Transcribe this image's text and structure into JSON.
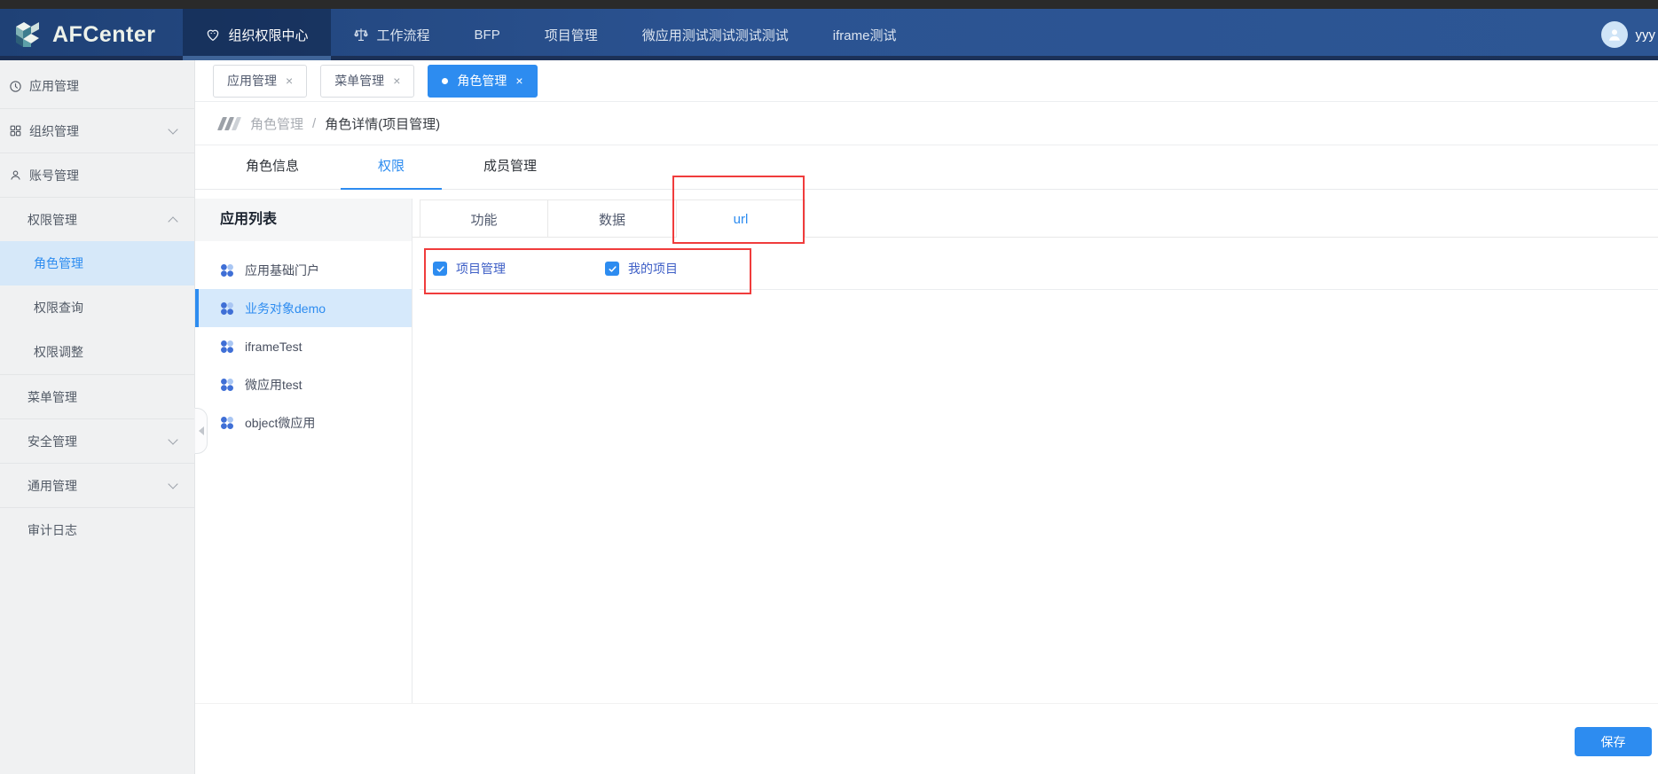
{
  "brand": {
    "name": "AFCenter"
  },
  "user": {
    "name": "yyy"
  },
  "glyphs": {
    "close": "×"
  },
  "topnav": {
    "items": [
      {
        "label": "组织权限中心",
        "icon": "heart-icon",
        "active": true
      },
      {
        "label": "工作流程",
        "icon": "scales-icon",
        "active": false
      },
      {
        "label": "BFP",
        "active": false
      },
      {
        "label": "项目管理",
        "active": false
      },
      {
        "label": "微应用测试测试测试测试",
        "active": false
      },
      {
        "label": "iframe测试",
        "active": false
      }
    ]
  },
  "sidebar": {
    "items": [
      {
        "label": "应用管理",
        "icon": "clock-icon"
      },
      {
        "label": "组织管理",
        "icon": "org-icon",
        "chevron": "down"
      },
      {
        "label": "账号管理",
        "icon": "user-icon"
      },
      {
        "label": "权限管理",
        "chevron": "up",
        "expanded": true
      },
      {
        "label": "角色管理",
        "sub": true,
        "selected": true
      },
      {
        "label": "权限查询",
        "sub": true
      },
      {
        "label": "权限调整",
        "sub": true
      },
      {
        "label": "菜单管理"
      },
      {
        "label": "安全管理",
        "chevron": "down"
      },
      {
        "label": "通用管理",
        "chevron": "down"
      },
      {
        "label": "审计日志"
      }
    ]
  },
  "open_tabs": {
    "items": [
      {
        "label": "应用管理",
        "active": false
      },
      {
        "label": "菜单管理",
        "active": false
      },
      {
        "label": "角色管理",
        "active": true
      }
    ]
  },
  "breadcrumb": {
    "parent": "角色管理",
    "separator": "/",
    "current": "角色详情(项目管理)"
  },
  "detail_tabs": {
    "items": [
      {
        "label": "角色信息",
        "active": false
      },
      {
        "label": "权限",
        "active": true
      },
      {
        "label": "成员管理",
        "active": false
      }
    ]
  },
  "app_list": {
    "title": "应用列表",
    "items": [
      {
        "label": "应用基础门户",
        "selected": false
      },
      {
        "label": "业务对象demo",
        "selected": true
      },
      {
        "label": "iframeTest",
        "selected": false
      },
      {
        "label": "微应用test",
        "selected": false
      },
      {
        "label": "object微应用",
        "selected": false
      }
    ]
  },
  "perm_tabs": {
    "items": [
      {
        "label": "功能",
        "active": false
      },
      {
        "label": "数据",
        "active": false
      },
      {
        "label": "url",
        "active": true
      }
    ]
  },
  "url_permissions": {
    "items": [
      {
        "label": "项目管理",
        "checked": true
      },
      {
        "label": "我的项目",
        "checked": true
      }
    ]
  },
  "footer": {
    "save_label": "保存"
  },
  "colors": {
    "accent": "#2d8cf0",
    "annotation": "#f03c3c",
    "navbar_from": "#1f4176",
    "navbar_to": "#2d5694"
  }
}
